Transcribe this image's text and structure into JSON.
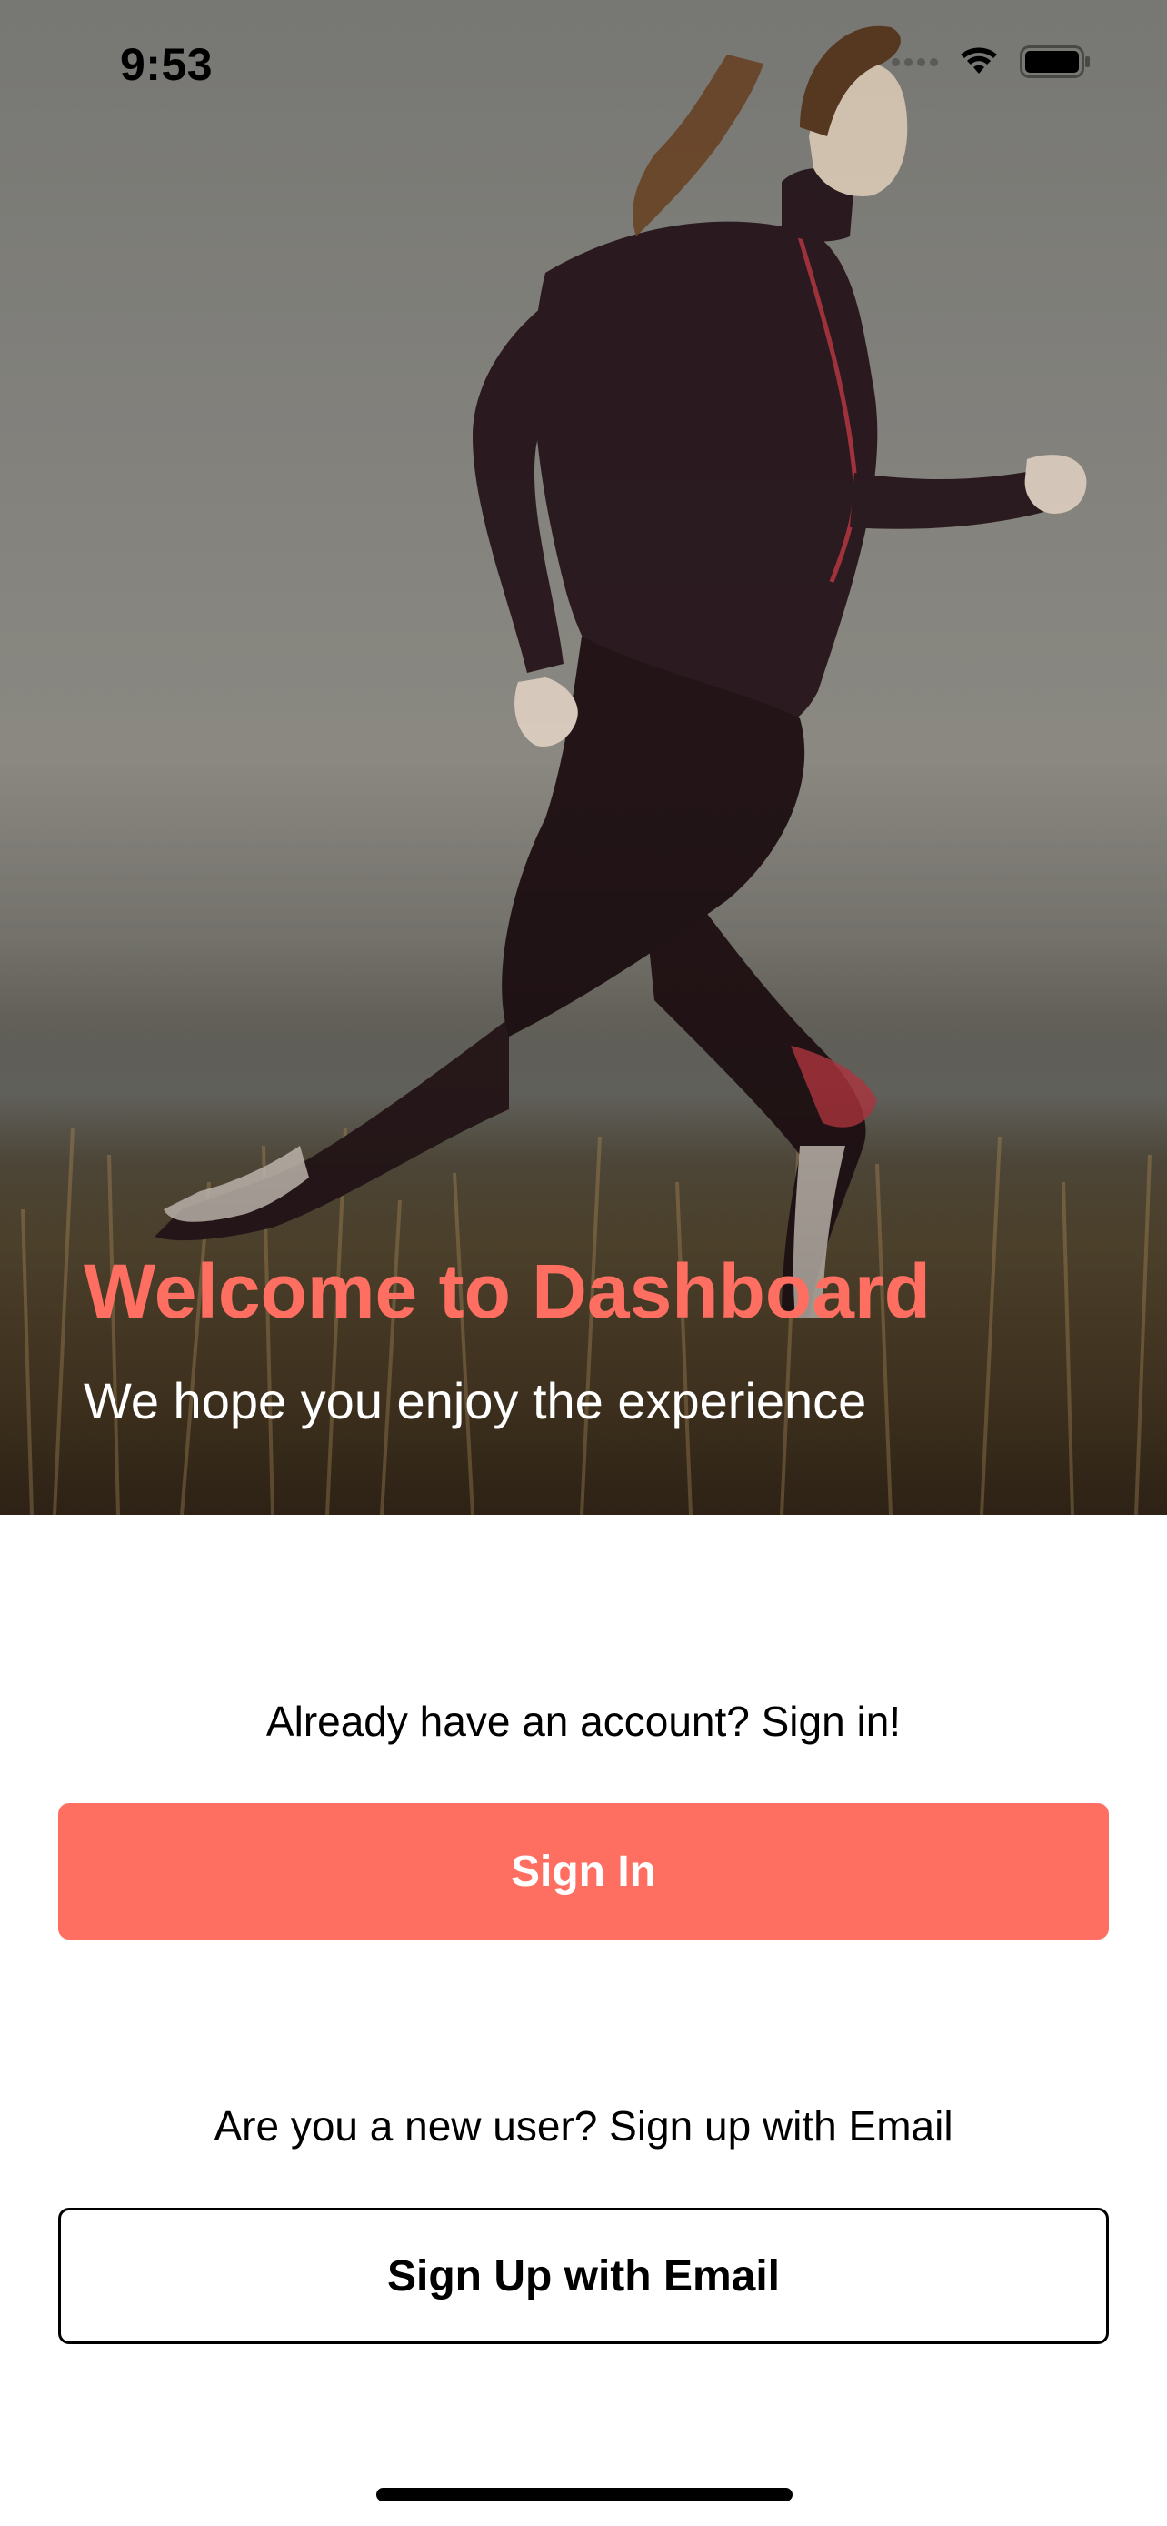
{
  "status_bar": {
    "time": "9:53",
    "icons": [
      "cellular-signal-icon",
      "wifi-icon",
      "battery-icon"
    ]
  },
  "hero": {
    "image": "woman-running-in-field-photo",
    "title": "Welcome to Dashboard",
    "subtitle": "We hope you enjoy the experience",
    "title_color": "#ff6f61",
    "subtitle_color": "#ffffff"
  },
  "sign_in": {
    "prompt": "Already have an account? Sign in!",
    "button_label": "Sign In",
    "button_color": "#ff6f61"
  },
  "sign_up": {
    "prompt": "Are you a new user? Sign up with Email",
    "button_label": "Sign Up with Email"
  }
}
